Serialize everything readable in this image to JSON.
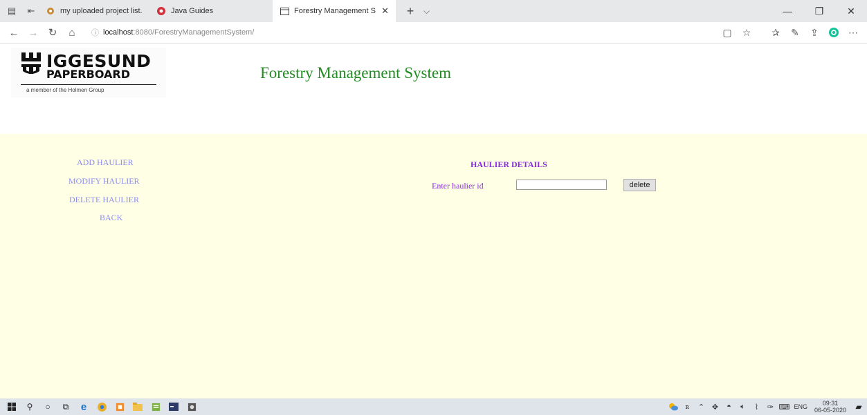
{
  "browser": {
    "tabs": [
      {
        "title": "my uploaded project list.do",
        "state": "inactive",
        "icon": "word-document-icon"
      },
      {
        "title": "Java Guides",
        "state": "inactive",
        "icon": "java-guides-icon"
      },
      {
        "title": "Forestry Management S",
        "state": "active",
        "icon": "page-icon"
      }
    ],
    "new_tab_symbol": "+",
    "tab_menu_symbol": "⌵",
    "address": {
      "host": "localhost",
      "path": ":8080/ForestryManagementSystem/"
    }
  },
  "page": {
    "logo": {
      "line1": "IGGESUND",
      "line2": "PAPERBOARD",
      "tagline": "a member of the Holmen Group"
    },
    "title": "Forestry Management System",
    "nav": [
      {
        "label": "ADD HAULIER"
      },
      {
        "label": "MODIFY HAULIER"
      },
      {
        "label": "DELETE HAULIER"
      },
      {
        "label": "BACK"
      }
    ],
    "form": {
      "heading": "HAULIER DETAILS",
      "field_label": "Enter haulier id",
      "field_value": "",
      "button_label": "delete"
    }
  },
  "taskbar": {
    "language": "ENG",
    "time": "09:31",
    "date": "06-05-2020"
  },
  "colors": {
    "title_green": "#228b22",
    "heading_purple": "#8a2be2",
    "link_blue": "#8c8cf0",
    "content_bg": "#ffffe6"
  }
}
